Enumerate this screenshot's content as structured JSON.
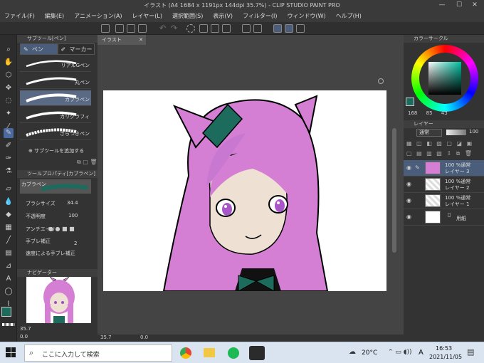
{
  "window": {
    "title": "イラスト (A4 1684 x 1191px 144dpi 35.7%) - CLIP STUDIO PAINT PRO",
    "minimize": "—",
    "maximize": "☐",
    "close": "✕"
  },
  "menu": [
    "ファイル(F)",
    "編集(E)",
    "アニメーション(A)",
    "レイヤー(L)",
    "選択範囲(S)",
    "表示(V)",
    "フィルター(I)",
    "ウィンドウ(W)",
    "ヘルプ(H)"
  ],
  "subtool": {
    "header": "サブツール[ペン]",
    "tabs": [
      "ペン",
      "マーカー"
    ],
    "brushes": [
      "リアルGペン",
      "丸ペン",
      "カブラペン",
      "カリグラフィ",
      "ざらつきペン"
    ],
    "selected_index": 2,
    "add_label": "サブツールを追加する"
  },
  "toolprop": {
    "header": "ツールプロパティ[カブラペン]",
    "name": "カブラペン",
    "brush_size_label": "ブラシサイズ",
    "brush_size_value": "34.4",
    "opacity_label": "不透明度",
    "opacity_value": "100",
    "aa_label": "アンチエイリ",
    "stabilize_label": "手ブレ補正",
    "stabilize_value": "2",
    "speed_label": "速度による手ブレ補正"
  },
  "navigator": {
    "header": "ナビゲーター",
    "zoom_value": "35.7",
    "angle_value": "0.0"
  },
  "canvas": {
    "tab_label": "イラスト",
    "zoom_value": "35.7",
    "angle_value": "0.0"
  },
  "color_wheel": {
    "header": "カラーサークル",
    "h_value": "168",
    "s_value": "85",
    "v_value": "43",
    "main_color": "#1d6b5c"
  },
  "layers": {
    "header": "レイヤー",
    "blend_mode": "通常",
    "opacity": "100",
    "items": [
      {
        "line1": "100 %通常",
        "line2": "レイヤー 3"
      },
      {
        "line1": "100 %通常",
        "line2": "レイヤー 2"
      },
      {
        "line1": "100 %通常",
        "line2": "レイヤー 1"
      },
      {
        "line1": "",
        "line2": "用紙"
      }
    ]
  },
  "taskbar": {
    "search_placeholder": "ここに入力して検索",
    "temperature": "20°C",
    "ime": "A",
    "time": "16:53",
    "date": "2021/11/05"
  }
}
